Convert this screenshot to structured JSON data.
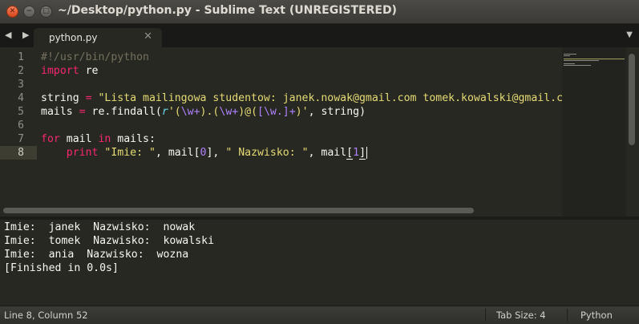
{
  "window": {
    "title": "~/Desktop/python.py - Sublime Text (UNREGISTERED)",
    "close_glyph": "✕",
    "minimize_glyph": "−",
    "maximize_glyph": "□"
  },
  "tabs": {
    "nav_arrows": "◀ ▶",
    "active_tab": {
      "label": "python.py",
      "close_glyph": "✕"
    },
    "dropdown_glyph": "▼"
  },
  "editor": {
    "line_numbers": [
      "1",
      "2",
      "3",
      "4",
      "5",
      "6",
      "7",
      "8"
    ],
    "active_line": 8,
    "lines": [
      {
        "segments": [
          {
            "text": "#!/usr/bin/python",
            "type": "comment"
          }
        ]
      },
      {
        "segments": [
          {
            "text": "import",
            "type": "kw"
          },
          {
            "text": " re",
            "type": "plain"
          }
        ]
      },
      {
        "segments": []
      },
      {
        "segments": [
          {
            "text": "string ",
            "type": "plain"
          },
          {
            "text": "=",
            "type": "kw"
          },
          {
            "text": " \"Lista mailingowa studentow: janek.nowak@gmail.com tomek.kowalski@gmail.c",
            "type": "str"
          }
        ]
      },
      {
        "segments": [
          {
            "text": "mails ",
            "type": "plain"
          },
          {
            "text": "=",
            "type": "kw"
          },
          {
            "text": " re.findall(",
            "type": "plain"
          },
          {
            "text": "r",
            "type": "raw"
          },
          {
            "text": "'(",
            "type": "str"
          },
          {
            "text": "\\w+",
            "type": "re"
          },
          {
            "text": ").(",
            "type": "str"
          },
          {
            "text": "\\w+",
            "type": "re"
          },
          {
            "text": ")@(",
            "type": "str"
          },
          {
            "text": "[\\w.]+",
            "type": "re"
          },
          {
            "text": ")'",
            "type": "str"
          },
          {
            "text": ", string)",
            "type": "plain"
          }
        ]
      },
      {
        "segments": []
      },
      {
        "segments": [
          {
            "text": "for",
            "type": "kw"
          },
          {
            "text": " mail ",
            "type": "plain"
          },
          {
            "text": "in",
            "type": "kw"
          },
          {
            "text": " mails:",
            "type": "plain"
          }
        ]
      },
      {
        "segments": [
          {
            "text": "    ",
            "type": "plain"
          },
          {
            "text": "print",
            "type": "kw"
          },
          {
            "text": " ",
            "type": "plain"
          },
          {
            "text": "\"Imie: \"",
            "type": "str"
          },
          {
            "text": ", mail[",
            "type": "plain"
          },
          {
            "text": "0",
            "type": "re"
          },
          {
            "text": "], ",
            "type": "plain"
          },
          {
            "text": "\" Nazwisko: \"",
            "type": "str"
          },
          {
            "text": ", mail",
            "type": "plain"
          },
          {
            "text": "[",
            "type": "bracket"
          },
          {
            "text": "1",
            "type": "re"
          },
          {
            "text": "]",
            "type": "bracket"
          },
          {
            "text": "",
            "type": "cursor"
          }
        ]
      }
    ]
  },
  "console": {
    "lines": [
      "Imie:  janek  Nazwisko:  nowak",
      "Imie:  tomek  Nazwisko:  kowalski",
      "Imie:  ania  Nazwisko:  wozna",
      "[Finished in 0.0s]"
    ]
  },
  "status": {
    "position": "Line 8, Column 52",
    "tab_size": "Tab Size: 4",
    "syntax": "Python"
  },
  "colors": {
    "background": "#272822",
    "keyword": "#f92672",
    "string": "#e6db74",
    "comment": "#75715e",
    "number": "#ae81ff",
    "storage": "#66d9ef"
  }
}
